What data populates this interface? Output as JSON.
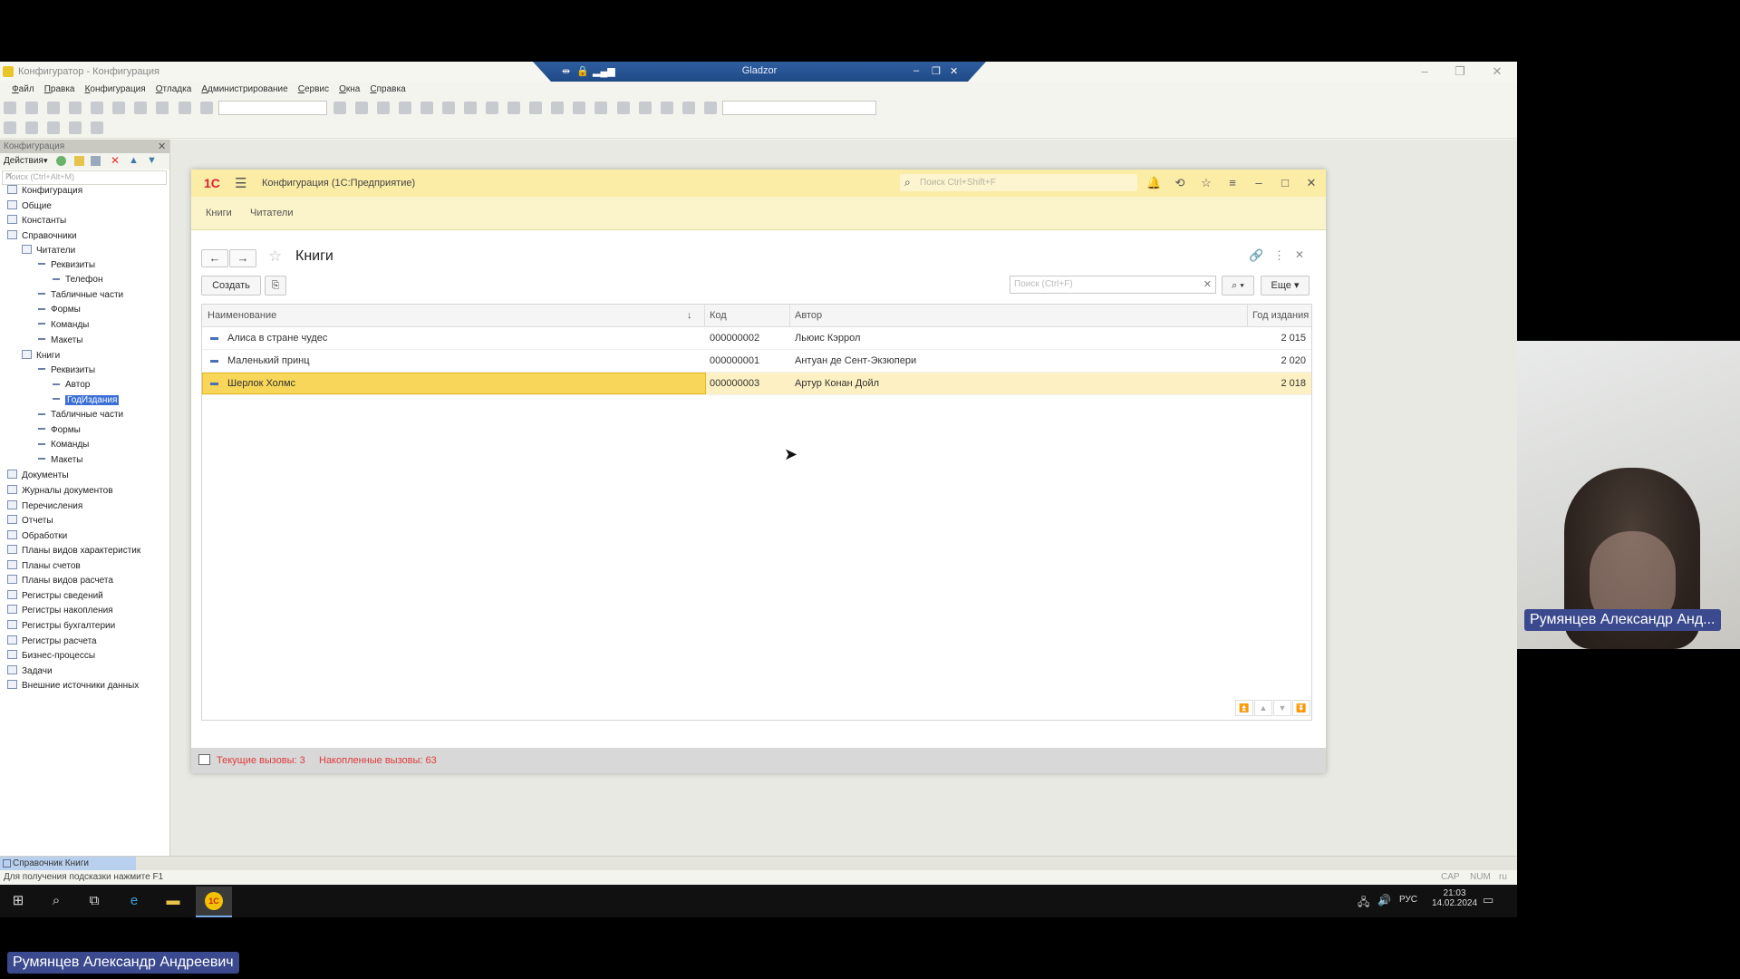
{
  "configurator": {
    "title": "Конфигуратор - Конфигурация",
    "menu": [
      "Файл",
      "Правка",
      "Конфигурация",
      "Отладка",
      "Администрирование",
      "Сервис",
      "Окна",
      "Справка"
    ],
    "tree_panel_title": "Конфигурация",
    "tree_actions_label": "Действия",
    "tree_search_placeholder": "Поиск (Ctrl+Alt+M)",
    "tree": [
      {
        "label": "Конфигурация",
        "level": 0
      },
      {
        "label": "Общие",
        "level": 0
      },
      {
        "label": "Константы",
        "level": 0
      },
      {
        "label": "Справочники",
        "level": 0
      },
      {
        "label": "Читатели",
        "level": 1
      },
      {
        "label": "Реквизиты",
        "level": 2
      },
      {
        "label": "Телефон",
        "level": 3
      },
      {
        "label": "Табличные части",
        "level": 2
      },
      {
        "label": "Формы",
        "level": 2
      },
      {
        "label": "Команды",
        "level": 2
      },
      {
        "label": "Макеты",
        "level": 2
      },
      {
        "label": "Книги",
        "level": 1
      },
      {
        "label": "Реквизиты",
        "level": 2
      },
      {
        "label": "Автор",
        "level": 3
      },
      {
        "label": "ГодИздания",
        "level": 3,
        "selected": true
      },
      {
        "label": "Табличные части",
        "level": 2
      },
      {
        "label": "Формы",
        "level": 2
      },
      {
        "label": "Команды",
        "level": 2
      },
      {
        "label": "Макеты",
        "level": 2
      },
      {
        "label": "Документы",
        "level": 0
      },
      {
        "label": "Журналы документов",
        "level": 0
      },
      {
        "label": "Перечисления",
        "level": 0
      },
      {
        "label": "Отчеты",
        "level": 0
      },
      {
        "label": "Обработки",
        "level": 0
      },
      {
        "label": "Планы видов характеристик",
        "level": 0
      },
      {
        "label": "Планы счетов",
        "level": 0
      },
      {
        "label": "Планы видов расчета",
        "level": 0
      },
      {
        "label": "Регистры сведений",
        "level": 0
      },
      {
        "label": "Регистры накопления",
        "level": 0
      },
      {
        "label": "Регистры бухгалтерии",
        "level": 0
      },
      {
        "label": "Регистры расчета",
        "level": 0
      },
      {
        "label": "Бизнес-процессы",
        "level": 0
      },
      {
        "label": "Задачи",
        "level": 0
      },
      {
        "label": "Внешние источники данных",
        "level": 0
      }
    ],
    "bottom_tab": "Справочник Книги",
    "status_hint": "Для получения подсказки нажмите F1",
    "status_indicators": [
      "CAP",
      "NUM",
      "ru"
    ]
  },
  "remote_banner": {
    "title": "Gladzor"
  },
  "enterprise": {
    "logo": "1С",
    "title": "Конфигурация  (1С:Предприятие)",
    "search_placeholder": "Поиск Ctrl+Shift+F",
    "sections": [
      "Книги",
      "Читатели"
    ],
    "form_title": "Книги",
    "create_button": "Создать",
    "grid_search_placeholder": "Поиск (Ctrl+F)",
    "more_button": "Еще",
    "columns": [
      "Наименование",
      "Код",
      "Автор",
      "Год издания"
    ],
    "rows": [
      {
        "name": "Алиса в стране чудес",
        "code": "000000002",
        "author": "Льюис Кэррол",
        "year": "2 015"
      },
      {
        "name": "Маленький принц",
        "code": "000000001",
        "author": "Антуан де Сент-Экзюпери",
        "year": "2 020"
      },
      {
        "name": "Шерлок Холмс",
        "code": "000000003",
        "author": "Артур Конан Дойл",
        "year": "2 018",
        "selected": true
      }
    ],
    "status_current_calls": "Текущие вызовы: 3",
    "status_accumulated_calls": "Накопленные вызовы: 63"
  },
  "taskbar": {
    "lang": "РУС",
    "time": "21:03",
    "date": "14.02.2024"
  },
  "participant": {
    "webcam_name": "Румянцев Александр Анд...",
    "bottom_name": "Румянцев Александр Андреевич"
  }
}
